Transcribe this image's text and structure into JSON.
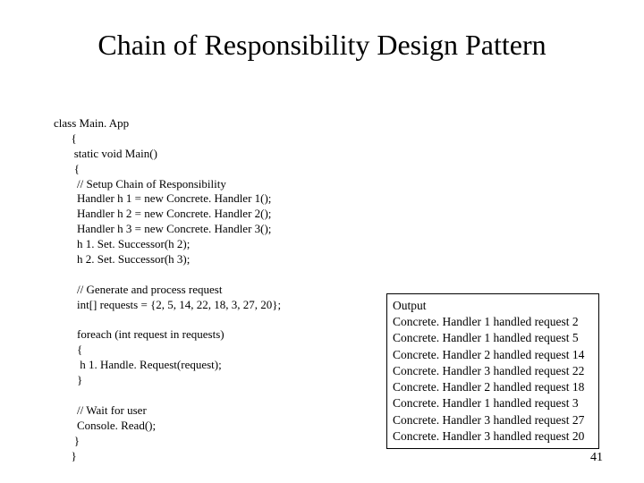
{
  "title": "Chain of Responsibility Design Pattern",
  "code": "class Main. App\n      {\n       static void Main()\n       {\n        // Setup Chain of Responsibility\n        Handler h 1 = new Concrete. Handler 1();\n        Handler h 2 = new Concrete. Handler 2();\n        Handler h 3 = new Concrete. Handler 3();\n        h 1. Set. Successor(h 2);\n        h 2. Set. Successor(h 3);\n\n        // Generate and process request\n        int[] requests = {2, 5, 14, 22, 18, 3, 27, 20};\n\n        foreach (int request in requests)\n        {\n         h 1. Handle. Request(request);\n        }\n\n        // Wait for user\n        Console. Read();\n       }\n      }",
  "output": {
    "header": "Output",
    "lines": [
      "Concrete. Handler 1 handled request 2",
      "Concrete. Handler 1 handled request 5",
      "Concrete. Handler 2 handled request 14",
      "Concrete. Handler 3 handled request 22",
      "Concrete. Handler 2 handled request 18",
      "Concrete. Handler 1 handled request 3",
      "Concrete. Handler 3 handled request 27",
      "Concrete. Handler 3 handled request 20"
    ]
  },
  "page_number": "41"
}
